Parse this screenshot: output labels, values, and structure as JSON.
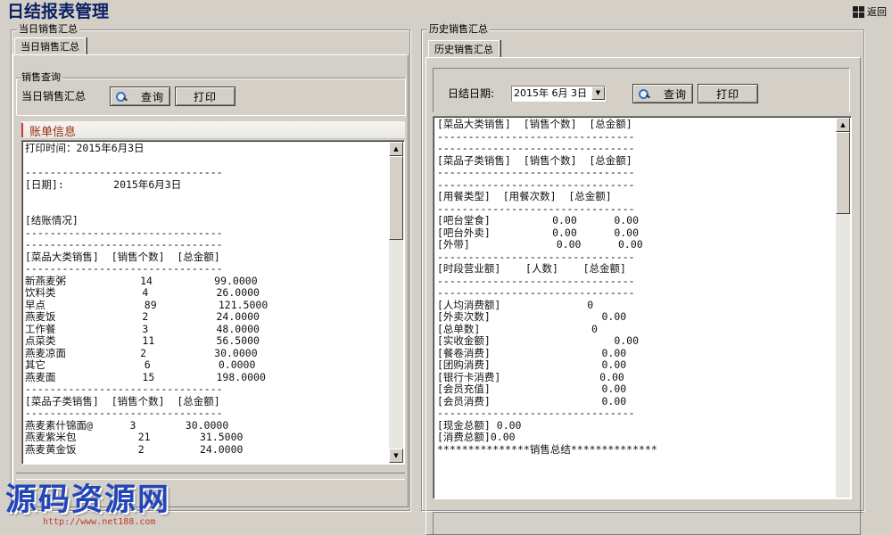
{
  "app": {
    "title": "日结报表管理",
    "back_label": "返回"
  },
  "today_panel": {
    "group_title": "当日销售汇总",
    "tab_label": "当日销售汇总",
    "query_group_title": "销售查询",
    "query_label": "当日销售汇总",
    "query_button": "查询",
    "print_button": "打印",
    "account_header": "账单信息",
    "report_text": "打印时间：2015年6月3日\n\n--------------------------------\n[日期]:        2015年6月3日\n\n\n[结账情况]\n--------------------------------\n--------------------------------\n[菜品大类销售]  [销售个数]  [总金额]\n--------------------------------\n新燕麦粥            14          99.0000\n饮料类              4           26.0000\n早点                89          121.5000\n燕麦饭              2           24.0000\n工作餐              3           48.0000\n点菜类              11          56.5000\n燕麦凉面            2           30.0000\n其它                6           0.0000\n燕麦面              15          198.0000\n--------------------------------\n[菜品子类销售]  [销售个数]  [总金额]\n--------------------------------\n燕麦素什锦面@      3        30.0000\n燕麦紫米包          21        31.5000\n燕麦黄金饭          2         24.0000"
  },
  "history_panel": {
    "group_title": "历史销售汇总",
    "tab_label": "历史销售汇总",
    "date_label": "日结日期:",
    "date_value": "2015年 6月 3日",
    "query_button": "查询",
    "print_button": "打印",
    "report_text": "[菜品大类销售]  [销售个数]  [总金额]\n--------------------------------\n--------------------------------\n[菜品子类销售]  [销售个数]  [总金额]\n--------------------------------\n--------------------------------\n[用餐类型]  [用餐次数]  [总金额]\n--------------------------------\n[吧台堂食]          0.00      0.00\n[吧台外卖]          0.00      0.00\n[外带]              0.00      0.00\n--------------------------------\n[时段营业额]    [人数]    [总金额]\n--------------------------------\n--------------------------------\n[人均消费额]              0\n[外卖次数]                  0.00\n[总单数]                  0\n[实收金额]                    0.00\n[餐卷消费]                  0.00\n[团购消费]                  0.00\n[银行卡消费]                0.00\n[会员充值]                  0.00\n[会员消费]                  0.00\n--------------------------------\n[现金总额] 0.00\n[消费总额]0.00\n***************销售总结**************"
  },
  "watermark": {
    "title": "源码资源网",
    "url": "http://www.net188.com"
  }
}
